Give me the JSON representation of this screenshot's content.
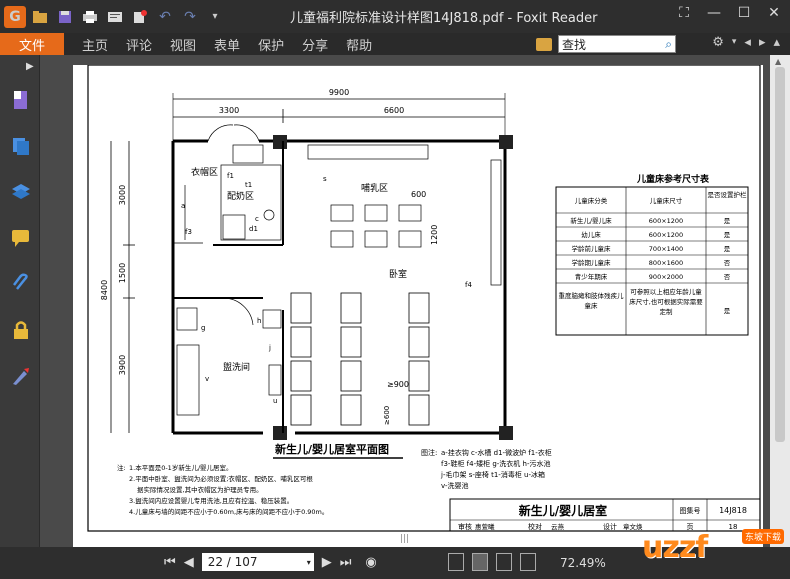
{
  "window": {
    "title": "儿童福利院标准设计样图14J818.pdf - Foxit Reader"
  },
  "quick_access": [
    "logo-icon",
    "open-icon",
    "save-icon",
    "print-icon",
    "properties-icon",
    "new-icon",
    "undo-icon",
    "redo-icon",
    "customize-icon"
  ],
  "menu": {
    "file": "文件",
    "items": [
      "主页",
      "评论",
      "视图",
      "表单",
      "保护",
      "分享",
      "帮助"
    ]
  },
  "search": {
    "value": "查找"
  },
  "toolbar": {
    "zoom": "72.49%",
    "page_current": "22 / 107"
  },
  "page": {
    "dims": {
      "top_total": "9900",
      "top_left": "3300",
      "top_right": "6600",
      "left_total": "8400",
      "left_a": "3000",
      "left_b": "1500",
      "left_c": "3900",
      "d600": "600",
      "d1200": "1200",
      "d900": "≥900",
      "d600b": "≥600"
    },
    "rooms": {
      "coat": "衣帽区",
      "milk": "配奶区",
      "feeding": "哺乳区",
      "bedroom": "卧室",
      "wash": "盥洗间"
    },
    "labels": {
      "a": "a",
      "f3": "f3",
      "f1": "f1",
      "t1": "t1",
      "c": "c",
      "d1": "d1",
      "s": "s",
      "f4": "f4",
      "g": "g",
      "h": "h",
      "j": "j",
      "v": "v",
      "u": "u"
    },
    "plan_title": "新生儿/婴儿居室平面图",
    "legend": {
      "title": "图注:",
      "rows": [
        "a-挂衣钩  c-水槽  d1-微波炉  f1-衣柜",
        "f3-鞋柜  f4-矮柜  g-洗衣机  h-污水池",
        "j-毛巾架  s-座椅  t1-消毒柜  u-冰箱",
        "v-洗婴池"
      ]
    },
    "notes": {
      "title": "注:",
      "rows": [
        "1.本平面是0-1岁新生儿/婴儿居室。",
        "2.平面中卧室、盥洗间为必须设置;衣帽区、配奶区、哺乳区可根",
        "据实际情况设置,其中衣帽区为护理员专用。",
        "3.盥洗间内应设置婴儿专用洗池,且应有控温、稳压装置。",
        "4.儿童床与墙的间距不应小于0.60m,床与床的间距不应小于0.90m。"
      ]
    },
    "table": {
      "title": "儿童床参考尺寸表",
      "headers": [
        "儿童床分类",
        "儿童床尺寸",
        "是否设置护栏"
      ],
      "rows": [
        [
          "新生儿/婴儿床",
          "600×1200",
          "是"
        ],
        [
          "幼儿床",
          "600×1200",
          "是"
        ],
        [
          "学龄前儿童床",
          "700×1400",
          "是"
        ],
        [
          "学龄期儿童床",
          "800×1600",
          "否"
        ],
        [
          "青少年期床",
          "900×2000",
          "否"
        ],
        [
          "重度脑瘫和肢体残疾儿童床",
          "可参照以上相应年龄儿童床尺寸,也可根据实际需要定制",
          "是"
        ]
      ]
    },
    "titleblock": {
      "title": "新生儿/婴儿居室",
      "atlas_label": "图集号",
      "atlas_no": "14J818",
      "review": "审核",
      "reviewer": "惠萱曦",
      "check": "校对",
      "checker": "云燕",
      "design": "设计",
      "designer": "章文焕",
      "page_label": "页",
      "page_no": "18"
    }
  },
  "watermark": {
    "brand": "uzzf",
    "tag": "东坡下载"
  },
  "colors": {
    "accent": "#e66a1a",
    "chrome": "#2e2e2e",
    "wall": "#000000"
  }
}
